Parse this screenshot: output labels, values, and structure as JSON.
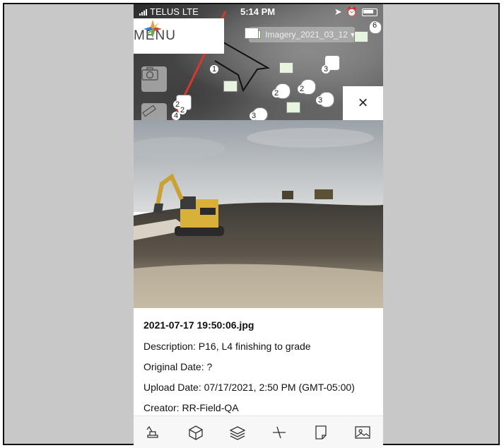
{
  "status_bar": {
    "carrier": "TELUS",
    "network": "LTE",
    "time": "5:14 PM"
  },
  "menu": {
    "label": "MENU"
  },
  "map": {
    "layer_name": "Imagery_2021_03_12",
    "pin_counts": [
      "1",
      "2",
      "2",
      "3",
      "3",
      "2",
      "3",
      "2",
      "4",
      "6"
    ]
  },
  "close_label": "×",
  "photo_detail": {
    "filename": "2021-07-17 19:50:06.jpg",
    "description": "Description: P16, L4 finishing to grade",
    "original_date": "Original Date: ?",
    "upload_date": "Upload Date: 07/17/2021, 2:50 PM (GMT-05:00)",
    "creator": "Creator: RR-Field-QA"
  },
  "tab_bar": {
    "items": [
      {
        "icon": "excavator-icon"
      },
      {
        "icon": "cube-icon"
      },
      {
        "icon": "layers-icon"
      },
      {
        "icon": "measure-icon"
      },
      {
        "icon": "document-icon"
      },
      {
        "icon": "image-icon"
      }
    ]
  }
}
